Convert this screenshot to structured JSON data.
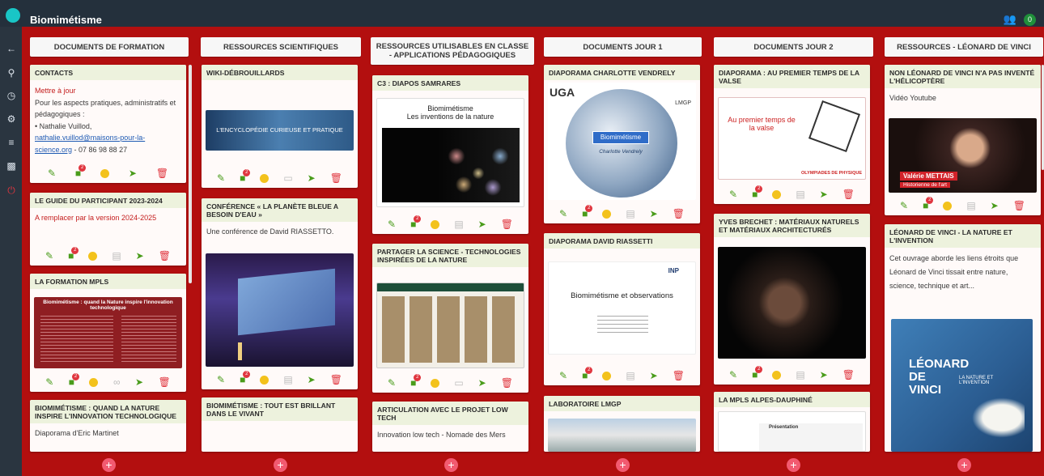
{
  "app": {
    "title": "Biomimétisme",
    "users_icon": "users-icon",
    "user_count": "0"
  },
  "columns": [
    {
      "title": "DOCUMENTS DE FORMATION"
    },
    {
      "title": "RESSOURCES SCIENTIFIQUES"
    },
    {
      "title": "RESSOURCES UTILISABLES EN CLASSE - APPLICATIONS PÉDAGOGIQUES"
    },
    {
      "title": "DOCUMENTS JOUR 1"
    },
    {
      "title": "DOCUMENTS JOUR 2"
    },
    {
      "title": "RESSOURCES - LÉONARD DE VINCI"
    }
  ],
  "cards": {
    "contacts": {
      "title": "CONTACTS",
      "update": "Mettre à jour",
      "intro": "Pour les aspects pratiques, administratifs et pédagogiques :",
      "name": "• Nathalie Vuillod,",
      "email": "nathalie.vuillod@maisons-pour-la-science.org",
      "phone": " - 07 86 98 88 27"
    },
    "guide": {
      "title": "LE GUIDE DU PARTICIPANT 2023-2024",
      "note": "A remplacer par la version 2024-2025"
    },
    "formation": {
      "title": "LA FORMATION MPLS",
      "thumb_title": "Biomimétisme : quand la Nature inspire l'innovation technologique"
    },
    "biomim_nature": {
      "title": "BIOMIMÉTISME : QUAND LA NATURE INSPIRE L'INNOVATION TECHNOLOGIQUE",
      "text": "Diaporama d'Eric Martinet"
    },
    "wiki": {
      "title": "WIKI-DÉBROUILLARDS",
      "thumb_text": "L'ENCYCLOPÉDIE CURIEUSE ET PRATIQUE"
    },
    "planete": {
      "title": "CONFÉRENCE « LA PLANÈTE BLEUE A BESOIN D'EAU »",
      "text": "Une conférence de David RIASSETTO."
    },
    "brillant": {
      "title": "BIOMIMÉTISME : TOUT EST BRILLANT DANS LE VIVANT"
    },
    "c3": {
      "title": "C3 : DIAPOS SAMRARES",
      "slide_title": "Biomimétisme",
      "slide_sub": "Les inventions de la nature"
    },
    "partager": {
      "title": "PARTAGER LA SCIENCE - TECHNOLOGIES INSPIRÉES DE LA NATURE"
    },
    "lowtech": {
      "title": "ARTICULATION AVEC LE PROJET LOW TECH",
      "text": "Innovation low tech - Nomade des Mers"
    },
    "charlotte": {
      "title": "DIAPORAMA CHARLOTTE VENDRELY",
      "logo_left": "UGA",
      "logo_right": "LMGP",
      "banner": "Biomimétisme",
      "author": "Charlotte Vendrely"
    },
    "riassetti": {
      "title": "DIAPORAMA DAVID RIASSETTI",
      "slide_title": "Biomimétisme et observations",
      "logo": "INP"
    },
    "lmgp": {
      "title": "LABORATOIRE LMGP"
    },
    "valse": {
      "title": "DIAPORAMA : AU PREMIER TEMPS DE LA VALSE",
      "slide_title": "Au premier temps de la valse",
      "footer": "OLYMPIADES DE PHYSIQUE"
    },
    "brechet": {
      "title": "YVES BRECHET : MATÉRIAUX NATURELS ET MATÉRIAUX ARCHITECTURÉS"
    },
    "mpls": {
      "title": "LA MPLS ALPES-DAUPHINÉ",
      "thumb_text": "Présentation"
    },
    "helico": {
      "title": "NON LÉONARD DE VINCI N'A PAS INVENTÉ L'HÉLICOPTÈRE",
      "text": "Vidéo Youtube",
      "caption_name": "Valérie METTAIS",
      "caption_role": "Historienne de l'art"
    },
    "leonard": {
      "title": "LÉONARD DE VINCI - LA NATURE ET L'INVENTION",
      "text": "Cet ouvrage aborde les liens étroits que Léonard de Vinci tissait entre nature, science, technique et art...",
      "book_title": "LÉONARD DE VINCI",
      "book_sub": "LA NATURE ET L'INVENTION"
    }
  },
  "comment_count": "2",
  "add_label": "+"
}
